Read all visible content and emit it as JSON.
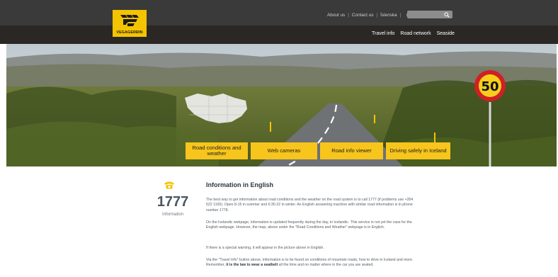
{
  "brand": {
    "logo_text": "VEGAGERÐIN",
    "accent": "#f5c400"
  },
  "utility": {
    "links": [
      "About us",
      "Contact us",
      "Íslenska"
    ],
    "separator": "|",
    "globe_icon": "globe-plus-icon"
  },
  "search": {
    "placeholder": "",
    "icon": "search-icon"
  },
  "mainnav": {
    "items": [
      "Travel info",
      "Road network",
      "Seaside"
    ]
  },
  "hero": {
    "sign_text": "50"
  },
  "tiles": [
    {
      "label": "Road conditions and weather"
    },
    {
      "label": "Web cameras"
    },
    {
      "label": "Road info viewer"
    },
    {
      "label": "Driving safely in Iceland"
    }
  ],
  "contact": {
    "icon": "phone-icon",
    "number": "1777",
    "label": "Information"
  },
  "content": {
    "title": "Information in English",
    "p1": "The best way to get information about road conditions and the weather on the road system is to call 1777 (if problems use +354 522 1100). Open 8-16 in summer and 6:30-22 in winter. An English answering machine with similar road information is in phone number 1778.",
    "p2": "On the Icelandic webpage, information is updated frequently during the day, in Icelandic. This service is not yet the case for the English webpage. However, the map, above under the \"Road Conditions and Weather\" webpage is in English.",
    "p3": "If there is a special warning, it will appear in the picture above in English.",
    "p4_a": "Via the \"Travel Info\" button above, information is to be found on conditions of mountain roads, how to drive in Iceland and more. Remember, ",
    "p4_b": "it is the law to wear a seatbelt",
    "p4_c": " all the time and no matter where in the car you are seated."
  }
}
